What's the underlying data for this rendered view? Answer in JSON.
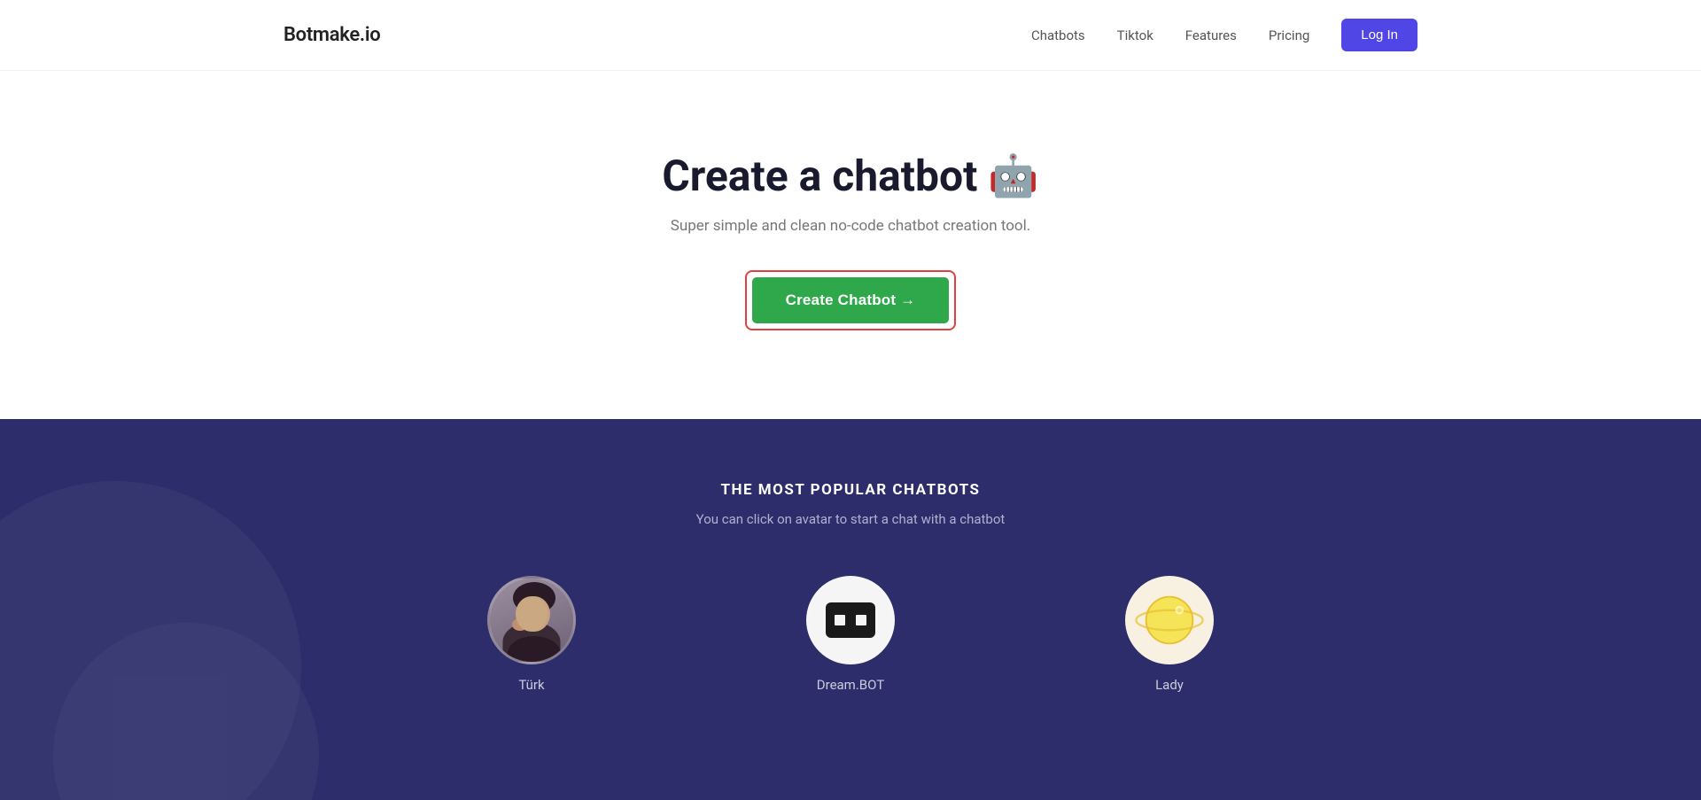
{
  "header": {
    "logo": "Botmake.io",
    "nav": {
      "items": [
        {
          "label": "Chatbots",
          "id": "chatbots"
        },
        {
          "label": "Tiktok",
          "id": "tiktok"
        },
        {
          "label": "Features",
          "id": "features"
        },
        {
          "label": "Pricing",
          "id": "pricing"
        }
      ],
      "login_label": "Log In"
    }
  },
  "hero": {
    "title": "Create a chatbot",
    "robot_emoji": "🤖",
    "subtitle": "Super simple and clean no-code chatbot creation tool.",
    "cta_label": "Create Chatbot →"
  },
  "popular": {
    "section_title": "THE MOST POPULAR CHATBOTS",
    "section_subtitle": "You can click on avatar to start a chat with a chatbot",
    "chatbots": [
      {
        "id": "turk",
        "name": "Türk"
      },
      {
        "id": "dream",
        "name": "Dream.BOT"
      },
      {
        "id": "lady",
        "name": "Lady"
      }
    ]
  },
  "colors": {
    "primary": "#4f46e5",
    "cta_green": "#2ea84a",
    "cta_red_border": "#e53e3e",
    "dark_bg": "#2d2d6b"
  }
}
